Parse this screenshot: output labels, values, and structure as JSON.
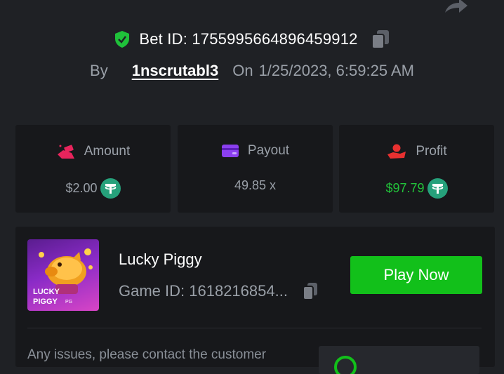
{
  "header": {
    "bet_id_label": "Bet ID: 1755995664896459912",
    "by_label": "By",
    "username": "1nscrutabl3",
    "on_label": "On",
    "datetime": "1/25/2023, 6:59:25 AM"
  },
  "stats": [
    {
      "label": "Amount",
      "value": "$2.00",
      "icon": "money-hand-icon"
    },
    {
      "label": "Payout",
      "value": "49.85 x",
      "icon": "wallet-icon"
    },
    {
      "label": "Profit",
      "value": "$97.79",
      "icon": "profit-hand-icon"
    }
  ],
  "game": {
    "name": "Lucky Piggy",
    "id_label": "Game ID: 1618216854...",
    "thumb_title_line1": "LUCKY",
    "thumb_title_line2": "PIGGY",
    "thumb_brand": "PG",
    "play_label": "Play Now"
  },
  "support": {
    "text": "Any issues, please contact the customer"
  },
  "colors": {
    "background": "#1f2125",
    "card": "#17181b",
    "accent_green": "#12c01a",
    "profit_green": "#22c33a",
    "tether": "#26a17b"
  }
}
